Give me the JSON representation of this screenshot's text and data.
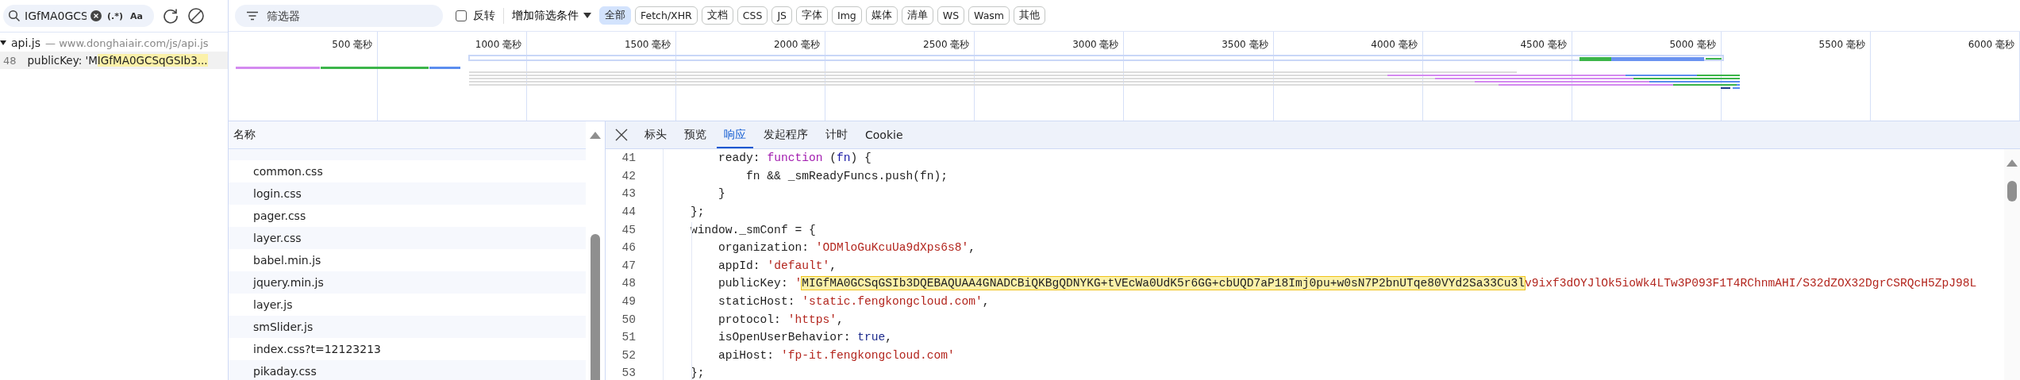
{
  "search": {
    "value": "IGfMA0GCS",
    "regex_label": "(.*)",
    "case_label": "Aa"
  },
  "search_results": [
    {
      "file": "api.js",
      "url": "— www.donghaiair.com/js/api.js",
      "expanded": true,
      "matches": [
        {
          "line": "48",
          "before": "publicKey: 'M",
          "match": "IGfMA0GCSqGSIb3..."
        }
      ]
    }
  ],
  "filter": {
    "placeholder": "筛选器",
    "invert_label": "反转",
    "invert_checked": false,
    "add_filter": "增加筛选条件"
  },
  "type_filters": [
    {
      "label": "全部",
      "selected": true
    },
    {
      "label": "Fetch/XHR",
      "selected": false
    },
    {
      "label": "文档",
      "selected": false
    },
    {
      "label": "CSS",
      "selected": false
    },
    {
      "label": "JS",
      "selected": false
    },
    {
      "label": "字体",
      "selected": false
    },
    {
      "label": "Img",
      "selected": false
    },
    {
      "label": "媒体",
      "selected": false
    },
    {
      "label": "清单",
      "selected": false
    },
    {
      "label": "WS",
      "selected": false
    },
    {
      "label": "Wasm",
      "selected": false
    },
    {
      "label": "其他",
      "selected": false
    }
  ],
  "timeline": {
    "ticks": [
      "500 毫秒",
      "1000 毫秒",
      "1500 毫秒",
      "2000 毫秒",
      "2500 毫秒",
      "3000 毫秒",
      "3500 毫秒",
      "4000 毫秒",
      "4500 毫秒",
      "5000 毫秒",
      "5500 毫秒",
      "6000 毫秒"
    ]
  },
  "name_column": {
    "header": "名称",
    "rows": [
      "common.css",
      "login.css",
      "pager.css",
      "layer.css",
      "babel.min.js",
      "jquery.min.js",
      "layer.js",
      "smSlider.js",
      "index.css?t=12123213",
      "pikaday.css"
    ]
  },
  "detail_tabs": [
    {
      "label": "标头",
      "selected": false
    },
    {
      "label": "预览",
      "selected": false
    },
    {
      "label": "响应",
      "selected": true
    },
    {
      "label": "发起程序",
      "selected": false
    },
    {
      "label": "计时",
      "selected": false
    },
    {
      "label": "Cookie",
      "selected": false
    }
  ],
  "code": [
    {
      "number": "41",
      "tokens": [
        {
          "kind": "plain",
          "text": "        ready: "
        },
        {
          "kind": "keyword",
          "text": "function"
        },
        {
          "kind": "plain",
          "text": " ("
        },
        {
          "kind": "param",
          "text": "fn"
        },
        {
          "kind": "plain",
          "text": ") {"
        }
      ]
    },
    {
      "number": "42",
      "tokens": [
        {
          "kind": "plain",
          "text": "            fn && _smReadyFuncs.push(fn);"
        }
      ]
    },
    {
      "number": "43",
      "tokens": [
        {
          "kind": "plain",
          "text": "        }"
        }
      ]
    },
    {
      "number": "44",
      "tokens": [
        {
          "kind": "plain",
          "text": "    };"
        }
      ]
    },
    {
      "number": "45",
      "tokens": [
        {
          "kind": "plain",
          "text": "    window._smConf = {"
        }
      ]
    },
    {
      "number": "46",
      "tokens": [
        {
          "kind": "plain",
          "text": "        organization: "
        },
        {
          "kind": "string",
          "text": "'ODMloGuKcuUa9dXps6s8'"
        },
        {
          "kind": "plain",
          "text": ","
        }
      ]
    },
    {
      "number": "47",
      "tokens": [
        {
          "kind": "plain",
          "text": "        appId: "
        },
        {
          "kind": "string",
          "text": "'default'"
        },
        {
          "kind": "plain",
          "text": ","
        }
      ]
    },
    {
      "number": "48",
      "tokens": [
        {
          "kind": "plain",
          "text": "        publicKey: "
        },
        {
          "kind": "string",
          "text": "'"
        },
        {
          "kind": "match",
          "text": "MIGfMA0GCSqGSIb3DQEBAQUAA4GNADCBiQKBgQDNYKG+tVEcWa0UdK5r6GG+cbUQD7aP18Imj0pu+w0sN7P2bnUTqe80VYd2Sa33Cu3l"
        },
        {
          "kind": "string",
          "text": "v9ixf3dOYJlOk5ioWk4LTw3P093F1T4RChnmAHI/S32dZOX32DgrCSRQcH5ZpJ98L"
        }
      ]
    },
    {
      "number": "49",
      "tokens": [
        {
          "kind": "plain",
          "text": "        staticHost: "
        },
        {
          "kind": "string",
          "text": "'static.fengkongcloud.com'"
        },
        {
          "kind": "plain",
          "text": ","
        }
      ]
    },
    {
      "number": "50",
      "tokens": [
        {
          "kind": "plain",
          "text": "        protocol: "
        },
        {
          "kind": "string",
          "text": "'https'"
        },
        {
          "kind": "plain",
          "text": ","
        }
      ]
    },
    {
      "number": "51",
      "tokens": [
        {
          "kind": "plain",
          "text": "        isOpenUserBehavior: "
        },
        {
          "kind": "bool",
          "text": "true"
        },
        {
          "kind": "plain",
          "text": ","
        }
      ]
    },
    {
      "number": "52",
      "tokens": [
        {
          "kind": "plain",
          "text": "        apiHost: "
        },
        {
          "kind": "string",
          "text": "'fp-it.fengkongcloud.com'"
        }
      ]
    },
    {
      "number": "53",
      "tokens": [
        {
          "kind": "plain",
          "text": "    };"
        }
      ]
    }
  ]
}
